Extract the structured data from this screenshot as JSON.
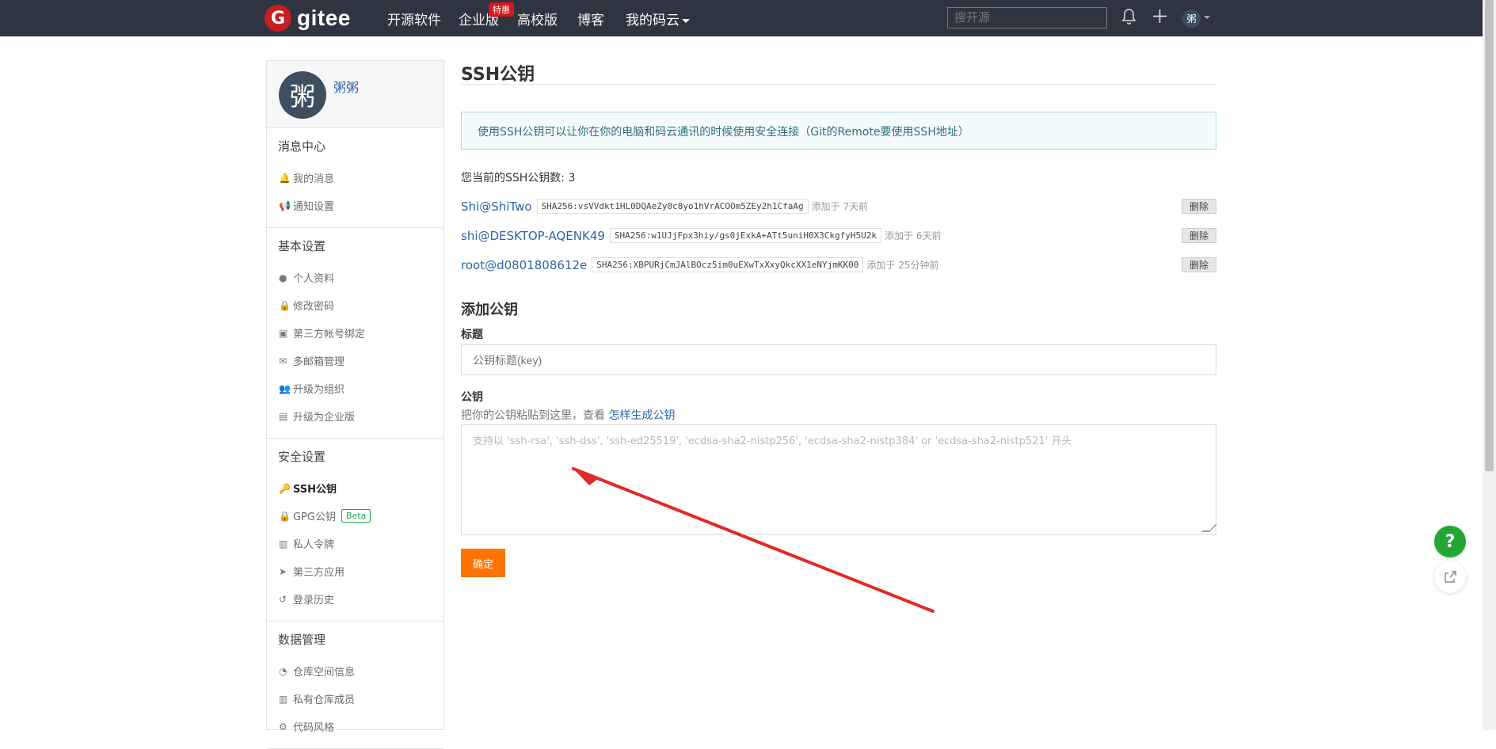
{
  "top_nav": {
    "logo_mark": "G",
    "logo_text": "gitee",
    "items": [
      "开源软件",
      "企业版",
      "高校版",
      "博客",
      "我的码云"
    ],
    "promo_badge": "特惠",
    "search_placeholder": "搜开源",
    "avatar_text": "粥",
    "bell_icon": "bell-icon",
    "plus_icon": "plus-icon"
  },
  "sidebar": {
    "avatar_text": "粥",
    "username": "粥粥",
    "sections": [
      {
        "title": "消息中心",
        "items": [
          {
            "icon": "bell-icon",
            "glyph": "🔔",
            "label": "我的消息"
          },
          {
            "icon": "megaphone-icon",
            "glyph": "📢",
            "label": "通知设置"
          }
        ]
      },
      {
        "title": "基本设置",
        "items": [
          {
            "icon": "user-icon",
            "glyph": "●",
            "label": "个人资料"
          },
          {
            "icon": "lock-icon",
            "glyph": "🔒",
            "label": "修改密码"
          },
          {
            "icon": "id-card-icon",
            "glyph": "▣",
            "label": "第三方帐号绑定"
          },
          {
            "icon": "mail-icon",
            "glyph": "✉",
            "label": "多邮箱管理"
          },
          {
            "icon": "users-icon",
            "glyph": "👥",
            "label": "升级为组织"
          },
          {
            "icon": "building-icon",
            "glyph": "▤",
            "label": "升级为企业版"
          }
        ]
      },
      {
        "title": "安全设置",
        "items": [
          {
            "icon": "key-icon",
            "glyph": "🔑",
            "label": "SSH公钥",
            "active": true
          },
          {
            "icon": "lock-icon",
            "glyph": "🔒",
            "label": "GPG公钥",
            "badge": "Beta"
          },
          {
            "icon": "token-icon",
            "glyph": "▥",
            "label": "私人令牌"
          },
          {
            "icon": "rocket-icon",
            "glyph": "➤",
            "label": "第三方应用"
          },
          {
            "icon": "history-icon",
            "glyph": "↺",
            "label": "登录历史"
          }
        ]
      },
      {
        "title": "数据管理",
        "items": [
          {
            "icon": "pie-chart-icon",
            "glyph": "◔",
            "label": "仓库空间信息"
          },
          {
            "icon": "member-icon",
            "glyph": "▥",
            "label": "私有仓库成员"
          },
          {
            "icon": "code-style-icon",
            "glyph": "⚙",
            "label": "代码风格"
          }
        ]
      }
    ]
  },
  "main": {
    "title": "SSH公钥",
    "info": "使用SSH公钥可以让你在你的电脑和码云通讯的时候使用安全连接（Git的Remote要使用SSH地址）",
    "count_text": "您当前的SSH公钥数: 3",
    "keys": [
      {
        "name": "Shi@ShiTwo",
        "fingerprint": "SHA256:vsVVdkt1HL0DQAeZy0c8yo1hVrACOOm5ZEy2h1CfaAg",
        "added": "添加于 7天前",
        "delete": "删除"
      },
      {
        "name": "shi@DESKTOP-AQENK49",
        "fingerprint": "SHA256:w1UJjFpx3hiy/gs0jExkA+ATt5uniH0X3CkgfyH5U2k",
        "added": "添加于 6天前",
        "delete": "删除"
      },
      {
        "name": "root@d0801808612e",
        "fingerprint": "SHA256:XBPURjCmJAlBOcz5im0uEXwTxXxyQkcXX1eNYjmKK00",
        "added": "添加于 25分钟前",
        "delete": "删除"
      }
    ],
    "add_title": "添加公钥",
    "title_label": "标题",
    "title_placeholder": "公钥标题(key)",
    "key_label": "公钥",
    "help_text": "把你的公钥粘贴到这里，查看",
    "help_link": "怎样生成公钥",
    "key_placeholder": "支持以 'ssh-rsa', 'ssh-dss', 'ssh-ed25519', 'ecdsa-sha2-nistp256', 'ecdsa-sha2-nistp384' or 'ecdsa-sha2-nistp521' 开头",
    "submit": "确定"
  },
  "floating": {
    "help": "?",
    "share_icon": "share-icon"
  },
  "colors": {
    "topbar": "#2e3440",
    "brand": "#c71d23",
    "link": "#2d64a7",
    "submit": "#ff7400",
    "annotation": "#e02b28"
  }
}
